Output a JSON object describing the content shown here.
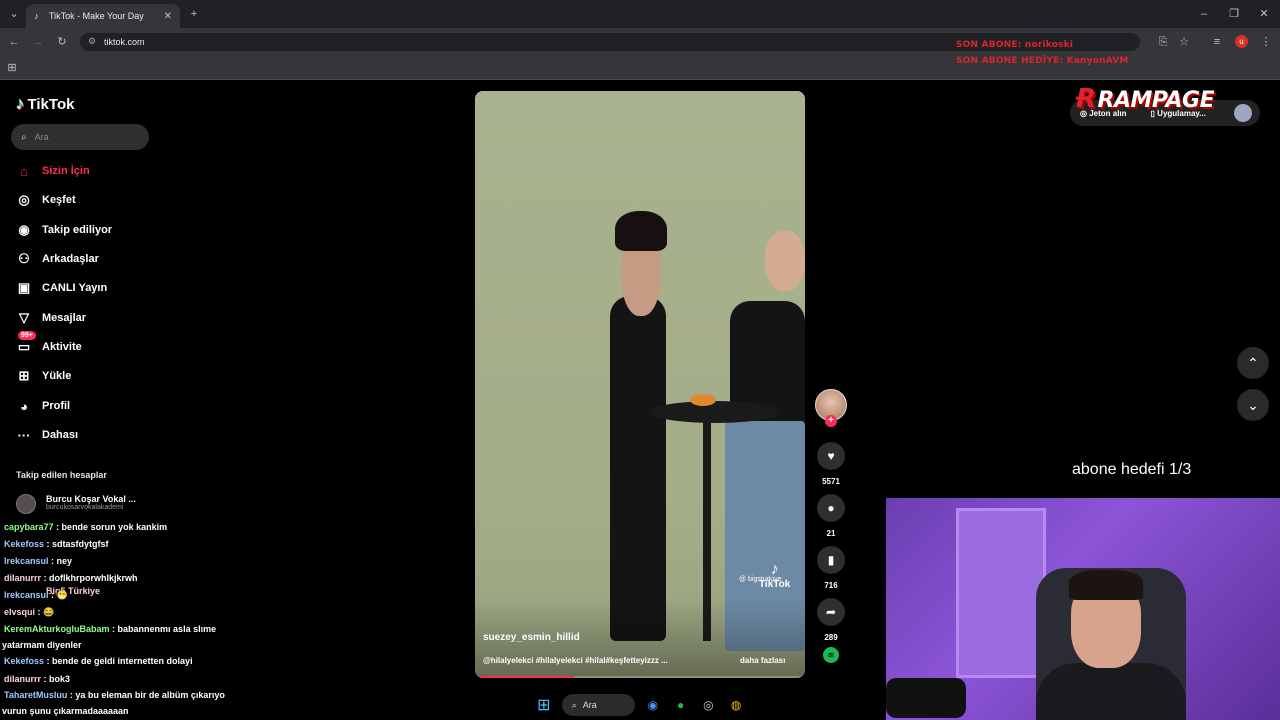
{
  "browser": {
    "tab_title": "TikTok - Make Your Day",
    "url": "tiktok.com",
    "profile_initial": "u"
  },
  "stream_overlay": {
    "last_sub": "SON ABONE: norikoski",
    "last_sub_gift": "SON ABONE HEDİYE: KanyonAVM",
    "brand": "RAMPAGE",
    "goal": "abone hedefi 1/3"
  },
  "tiktok": {
    "logo": "TikTok",
    "search_placeholder": "Ara",
    "nav": [
      {
        "label": "Sizin İçin",
        "icon": "home-icon",
        "glyph": "⌂"
      },
      {
        "label": "Keşfet",
        "icon": "compass-icon",
        "glyph": "◎"
      },
      {
        "label": "Takip ediliyor",
        "icon": "following-avatar-icon",
        "glyph": "◉"
      },
      {
        "label": "Arkadaşlar",
        "icon": "friends-icon",
        "glyph": "⚇"
      },
      {
        "label": "CANLI Yayın",
        "icon": "live-icon",
        "glyph": "▣"
      },
      {
        "label": "Mesajlar",
        "icon": "messages-icon",
        "glyph": "▽"
      },
      {
        "label": "Aktivite",
        "icon": "activity-icon",
        "glyph": "▭",
        "badge": "99+"
      },
      {
        "label": "Yükle",
        "icon": "upload-icon",
        "glyph": "⊞"
      },
      {
        "label": "Profil",
        "icon": "profile-avatar-icon",
        "glyph": "◕"
      },
      {
        "label": "Dahası",
        "icon": "more-icon",
        "glyph": "···"
      }
    ],
    "followed_title": "Takip edilen hesaplar",
    "followed": [
      {
        "name": "Burcu Koşar Vokal ...",
        "handle": "burcukosarvokalakademi"
      }
    ],
    "video": {
      "author": "suezey_esmin_hillid",
      "caption": "@hilalyelekci #hilalyelekci #hilal#keşfetteyizzz ...",
      "more": "daha fazlası",
      "watermark": "TikTok",
      "handle": "@ bigsturkiye",
      "progress": 0.3
    },
    "actions": {
      "likes": "5571",
      "comments": "21",
      "saves": "716",
      "shares": "289"
    },
    "topbar": {
      "coins": "Jeton alın",
      "app": "Uygulamay..."
    }
  },
  "chat": [
    {
      "user": "capybara77",
      "msg": ": bende sorun yok kankim",
      "cls": "green"
    },
    {
      "user": "Kekefoss",
      "msg": ": sdtasfdytgfsf",
      "cls": ""
    },
    {
      "user": "lrekcansul",
      "msg": ": ney",
      "cls": ""
    },
    {
      "user": "dilanurrr",
      "msg": ": doflkhrporwhlkjkrwh",
      "cls": "pink"
    },
    {
      "user": "Big5 Türkiye",
      "msg": "",
      "cls": "pink"
    },
    {
      "user": "lrekcansul",
      "msg": ": 😁",
      "cls": ""
    },
    {
      "user": "elvsqui",
      "msg": ": 😂",
      "cls": "pink"
    },
    {
      "user": "KeremAkturkogluBabam",
      "msg": ": babannenmı asla slıme",
      "cls": "green"
    },
    {
      "user": "",
      "msg": "yatarmam diyenler",
      "cls": ""
    },
    {
      "user": "Kekefoss",
      "msg": ": bende de geldi internetten dolayi",
      "cls": ""
    },
    {
      "user": "dilanurrr",
      "msg": ": bok3",
      "cls": "pink"
    },
    {
      "user": "TaharetMusluu",
      "msg": ": ya bu eleman bir de albüm çıkarıyo",
      "cls": ""
    },
    {
      "user": "",
      "msg": "vurun şunu çıkarmadaaaaaan",
      "cls": ""
    }
  ],
  "taskbar": {
    "search": "Ara"
  },
  "colors": {
    "accent": "#fe2c55",
    "overlay_red": "#e0232b",
    "spotify": "#1db954"
  }
}
